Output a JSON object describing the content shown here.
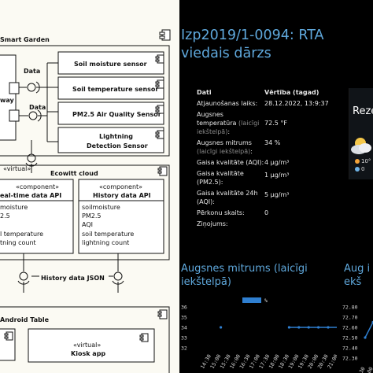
{
  "diagram": {
    "smart_garden_label": "Smart Garden",
    "gateway_label": "way",
    "data_label_1": "Data",
    "data_label_2": "Data",
    "sensors": [
      {
        "label": "Soil moisture sensor"
      },
      {
        "label": "Soil temperature sensor"
      },
      {
        "label": "PM2.5 Air Quality Sensor"
      },
      {
        "label_line1": "Lightning",
        "label_line2": "Detection Sensor"
      }
    ],
    "virtual_stereotype": "«virtual»",
    "ecowitt_cloud": "Ecowitt cloud",
    "component_stereotype": "«component»",
    "realtime_api": "eal-time data API",
    "history_api": "History data API",
    "realtime_fields": [
      "moisture",
      "2.5",
      "",
      "l temperature",
      "tning count"
    ],
    "history_fields": [
      "soilmoisture",
      "PM2.5",
      "AQI",
      "soil temperature",
      "lightning count"
    ],
    "history_json": "History data JSON",
    "android_table": "Android Table",
    "kiosk_stereotype": "«virtual»",
    "kiosk_app": "Kiosk app"
  },
  "dashboard": {
    "title": "Izp2019/1-0094: RTA viedais dārzs",
    "table": {
      "col_key": "Dati",
      "col_value": "Vērtība (tagad)",
      "rows": [
        {
          "key": "Atjaunošanas laiks:",
          "value": "28.12.2022, 13:9:37"
        },
        {
          "key": "Augsnes temperatūra",
          "key_muted": "(laicīgi iekštelpā)",
          "key_end": ":",
          "value": "72.5 °F"
        },
        {
          "key": "Augsnes mitrums",
          "key_muted": "(laicīgi iekštelpā)",
          "key_end": ":",
          "value": "34 %"
        },
        {
          "key": "Gaisa kvalitāte (AQI):",
          "value": "4 μg/m³"
        },
        {
          "key": "Gaisa kvalitāte (PM2.5):",
          "value": "1 μg/m³"
        },
        {
          "key": "Gaisa kvalitāte 24h (AQI):",
          "value": "5 μg/m³"
        },
        {
          "key": "Pērkonu skaits:",
          "value": "0"
        },
        {
          "key": "Ziņojums:",
          "value": ""
        }
      ]
    },
    "weather_widget": {
      "title": "Reze",
      "temp_fragment": "10°",
      "drop_fragment": "0"
    },
    "section_left_title": "Augsnes mitrums (laicīgi iekštelpā)",
    "section_right_title": "Aug iekš",
    "legend_unit": "%"
  },
  "chart_data": [
    {
      "type": "line",
      "title": "Augsnes mitrums (laicīgi iekštelpā)",
      "yticks": [
        36,
        35,
        34,
        33,
        32
      ],
      "ylim": [
        32,
        36
      ],
      "x": [
        "14:30",
        "15:00",
        "15:30",
        "16:00",
        "16:30",
        "17:00",
        "17:30",
        "18:00",
        "18:30",
        "19:00",
        "19:30",
        "20:00",
        "20:30",
        "21:00"
      ],
      "series": [
        {
          "name": "%",
          "values": [
            null,
            34,
            null,
            null,
            null,
            null,
            null,
            null,
            34,
            34,
            34,
            34,
            34,
            34
          ],
          "color": "#2f7fd0"
        }
      ]
    },
    {
      "type": "line",
      "title": "Aug iekš",
      "yticks": [
        72.8,
        72.7,
        72.6,
        72.5,
        72.4,
        72.3
      ],
      "ylim": [
        72.3,
        72.8
      ],
      "x": [
        "14:30",
        "15:00"
      ],
      "series": [
        {
          "name": "",
          "values": [
            72.5,
            72.65
          ],
          "color": "#2f7fd0"
        }
      ]
    }
  ]
}
